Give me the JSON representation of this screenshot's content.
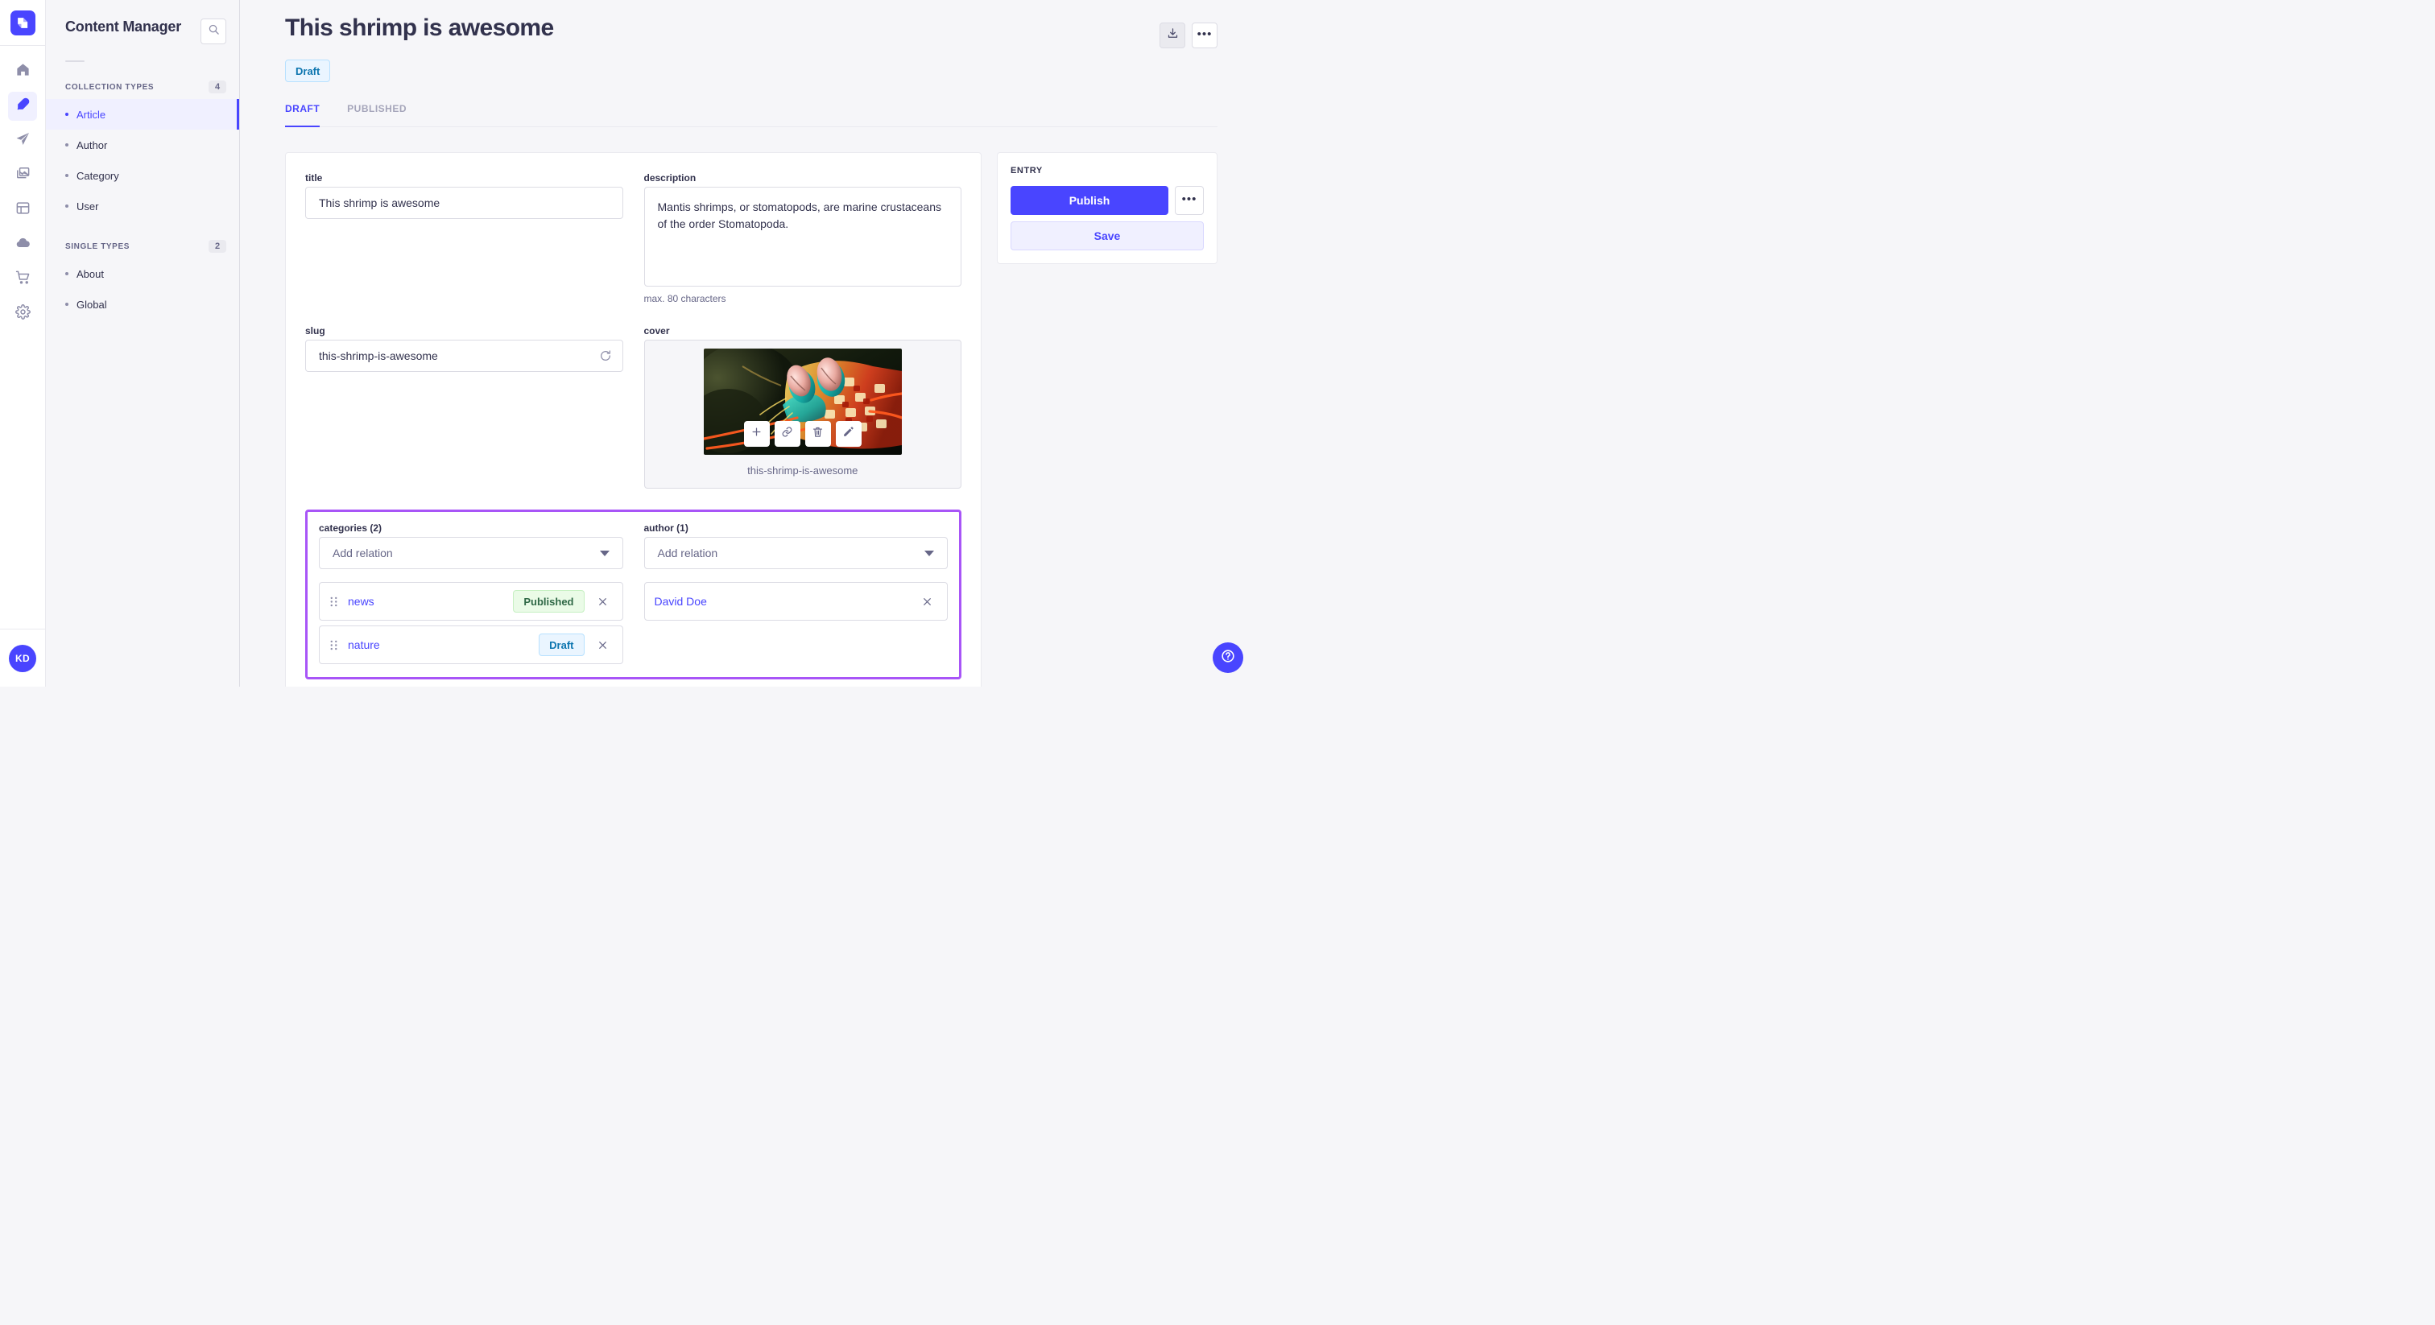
{
  "brand": {
    "logo_icon": "strapi-logo-icon",
    "accent": "#4945ff"
  },
  "rail": {
    "items": [
      {
        "icon": "home-icon",
        "active": false
      },
      {
        "icon": "feather-icon",
        "active": true
      },
      {
        "icon": "paper-plane-icon",
        "active": false
      },
      {
        "icon": "images-icon",
        "active": false
      },
      {
        "icon": "layout-icon",
        "active": false
      },
      {
        "icon": "cloud-icon",
        "active": false
      },
      {
        "icon": "shopping-cart-icon",
        "active": false
      },
      {
        "icon": "gear-icon",
        "active": false
      }
    ],
    "avatar_initials": "KD"
  },
  "sidebar": {
    "title": "Content Manager",
    "search_icon": "search-icon",
    "sections": [
      {
        "label": "COLLECTION TYPES",
        "count": "4",
        "items": [
          {
            "label": "Article",
            "active": true
          },
          {
            "label": "Author",
            "active": false
          },
          {
            "label": "Category",
            "active": false
          },
          {
            "label": "User",
            "active": false
          }
        ]
      },
      {
        "label": "SINGLE TYPES",
        "count": "2",
        "items": [
          {
            "label": "About",
            "active": false
          },
          {
            "label": "Global",
            "active": false
          }
        ]
      }
    ]
  },
  "header": {
    "title": "This shrimp is awesome",
    "status_badge": "Draft",
    "download_icon": "download-icon",
    "more_icon": "more-horizontal-icon"
  },
  "tabs": [
    {
      "label": "DRAFT",
      "active": true
    },
    {
      "label": "PUBLISHED",
      "active": false
    }
  ],
  "form": {
    "title": {
      "label": "title",
      "value": "This shrimp is awesome"
    },
    "description": {
      "label": "description",
      "value": "Mantis shrimps, or stomatopods, are marine crustaceans of the order Stomatopoda.",
      "hint": "max. 80 characters"
    },
    "slug": {
      "label": "slug",
      "value": "this-shrimp-is-awesome",
      "refresh_icon": "refresh-icon"
    },
    "cover": {
      "label": "cover",
      "file_name": "this-shrimp-is-awesome",
      "actions": [
        {
          "icon": "plus-icon"
        },
        {
          "icon": "link-icon"
        },
        {
          "icon": "trash-icon"
        },
        {
          "icon": "pencil-icon"
        }
      ]
    }
  },
  "relations": {
    "highlight_color": "#a855f7",
    "categories": {
      "label": "categories (2)",
      "select_placeholder": "Add relation",
      "items": [
        {
          "name": "news",
          "status": "Published",
          "status_type": "published",
          "drag_icon": "drag-handle-icon",
          "remove_icon": "close-icon"
        },
        {
          "name": "nature",
          "status": "Draft",
          "status_type": "draft",
          "drag_icon": "drag-handle-icon",
          "remove_icon": "close-icon"
        }
      ]
    },
    "author": {
      "label": "author (1)",
      "select_placeholder": "Add relation",
      "items": [
        {
          "name": "David Doe",
          "status": "",
          "remove_icon": "close-icon"
        }
      ]
    }
  },
  "entry_panel": {
    "title": "ENTRY",
    "publish_label": "Publish",
    "save_label": "Save",
    "more_icon": "more-horizontal-icon"
  },
  "help": {
    "icon": "question-mark-icon"
  }
}
